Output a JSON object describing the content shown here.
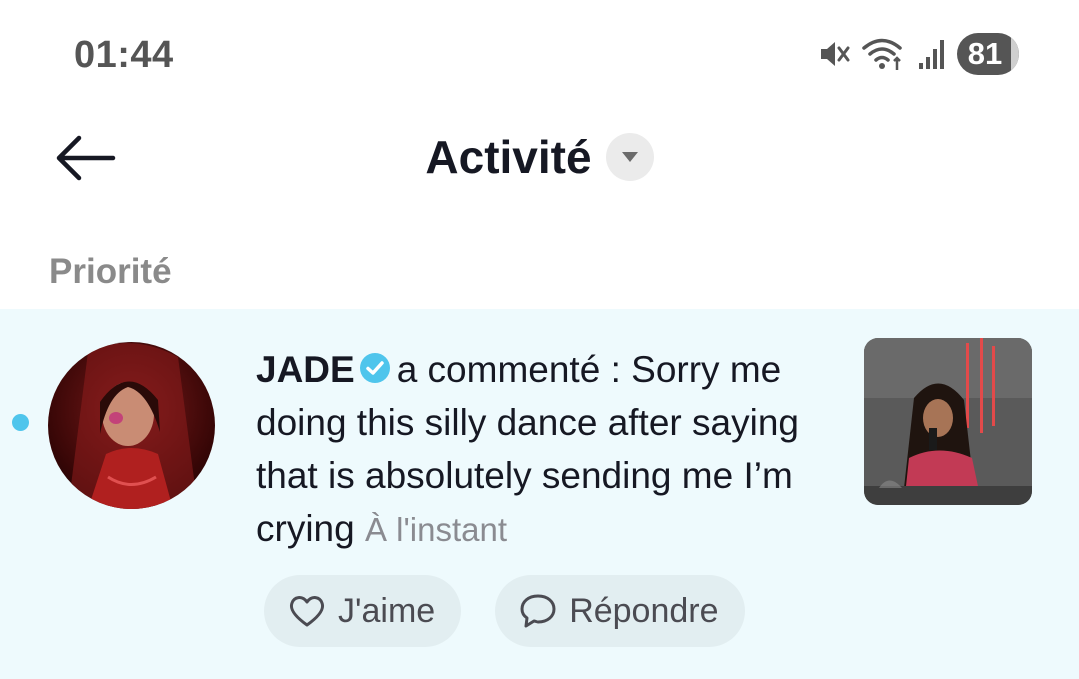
{
  "status_bar": {
    "time": "01:44",
    "battery": "81",
    "icons": [
      "mute-icon",
      "wifi-icon",
      "signal-icon",
      "battery-icon"
    ]
  },
  "header": {
    "back_icon": "arrow-left-icon",
    "title": "Activité",
    "dropdown_icon": "chevron-down-icon"
  },
  "section": {
    "title": "Priorité"
  },
  "notification": {
    "username": "JADE",
    "action": "a commenté : ",
    "comment": "Sorry me doing this silly dance after saying that is absolutely sending me I’m crying",
    "time": "À l'instant",
    "unread": true,
    "like_label": "J'aime",
    "reply_label": "Répondre"
  },
  "colors": {
    "accent": "#4fc5ec",
    "row_background": "#eefafd",
    "button_background": "#e2eef1",
    "verified": "#4fc5ec"
  }
}
